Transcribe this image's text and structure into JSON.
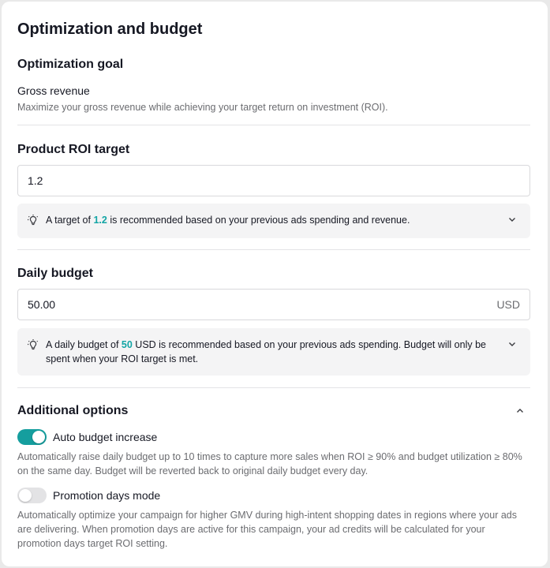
{
  "section": {
    "title": "Optimization and budget"
  },
  "optimization_goal": {
    "heading": "Optimization goal",
    "value": "Gross revenue",
    "description": "Maximize your gross revenue while achieving your target return on investment (ROI)."
  },
  "roi": {
    "heading": "Product ROI target",
    "input_value": "1.2",
    "tip_prefix": "A target of ",
    "tip_value": "1.2",
    "tip_suffix": " is recommended based on your previous ads spending and revenue."
  },
  "daily_budget": {
    "heading": "Daily budget",
    "input_value": "50.00",
    "currency": "USD",
    "tip_prefix": "A daily budget of ",
    "tip_value": "50",
    "tip_suffix": " USD is recommended based on your previous ads spending. Budget will only be spent when your ROI target is met."
  },
  "additional_options": {
    "heading": "Additional options",
    "auto_budget": {
      "label": "Auto budget increase",
      "enabled": true,
      "description": "Automatically raise daily budget up to 10 times to capture more sales when ROI ≥ 90% and budget utilization ≥ 80% on the same day. Budget will be reverted back to original daily budget every day."
    },
    "promotion_days": {
      "label": "Promotion days mode",
      "enabled": false,
      "description": "Automatically optimize your campaign for higher GMV during high-intent shopping dates in regions where your ads are delivering. When promotion days are active for this campaign, your ad credits will be calculated for your promotion days target ROI setting."
    }
  },
  "colors": {
    "accent": "#159e9e",
    "highlight_text": "#13a5a5"
  },
  "icons": {
    "tip": "lightbulb-icon",
    "expand": "chevron-down-icon",
    "collapse": "chevron-up-icon"
  }
}
